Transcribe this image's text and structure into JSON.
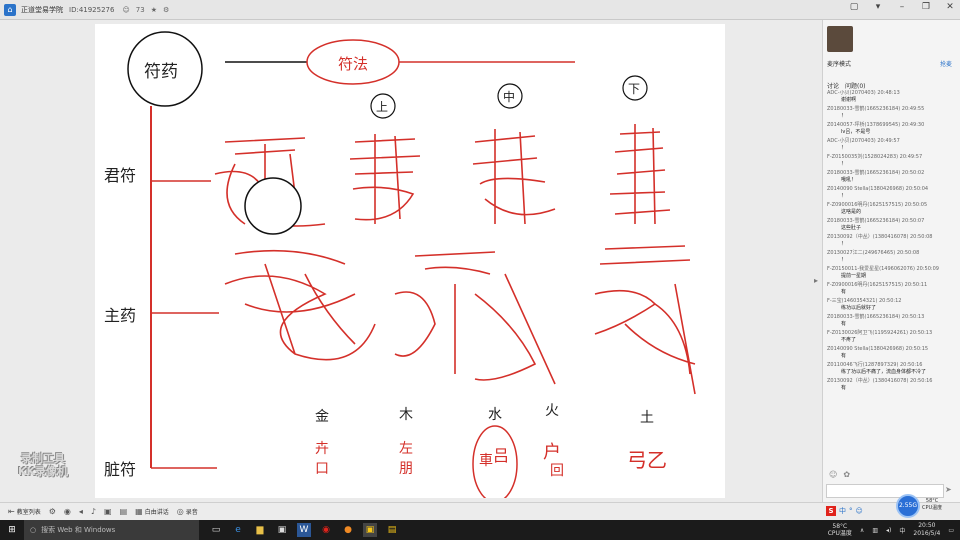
{
  "titlebar": {
    "title": "正道堂易学院",
    "id": "ID:41925276",
    "listeners": "73",
    "icons": [
      "app-icon",
      "people-icon",
      "star-icon",
      "settings-icon"
    ],
    "window_buttons": [
      "minimize",
      "restore",
      "close"
    ]
  },
  "slide": {
    "top_left": "符药",
    "top_center": "符法",
    "rows": [
      "君符",
      "主药",
      "脏符"
    ],
    "elements": [
      "金",
      "木",
      "水",
      "火",
      "土"
    ],
    "organs": [
      {
        "a": "卉",
        "b": "口"
      },
      {
        "a": "左",
        "b": "朋"
      },
      {
        "a": "車",
        "b": "吕"
      },
      {
        "a": "户",
        "b": "回"
      },
      {
        "a": "弓",
        "b": "乙"
      }
    ],
    "markers": [
      "上",
      "中",
      "下"
    ]
  },
  "watermark": {
    "line1": "录制工具",
    "line2": "KK录像机"
  },
  "panel": {
    "mode": "麦序模式",
    "signout": "抢麦",
    "tabs": [
      "讨论",
      "问题(0)"
    ],
    "messages": [
      {
        "head": "ADC-小贝(2070403) 20:48:13",
        "body": ""
      },
      {
        "head": "",
        "body": "谢谢啊"
      },
      {
        "head": "Z0180033-雪鹤(1665236184) 20:49:55",
        "body": "！"
      },
      {
        "head": "Z0140057-坪桥(1378699545) 20:49:30",
        "body": "lv吕，不是号"
      },
      {
        "head": "ADC-小贝(2070403) 20:49:57",
        "body": "！"
      },
      {
        "head": "F-Z0150035刘(1528024283) 20:49:57",
        "body": "！"
      },
      {
        "head": "Z0180033-雪鹤(1665236184) 20:50:02",
        "body": "哦吼！"
      },
      {
        "head": "Z0140090 Stella(1380426968) 20:50:04",
        "body": "！"
      },
      {
        "head": "F-Z0900016明丹(1625157515) 20:50:05",
        "body": "这啥是的"
      },
      {
        "head": "Z0180033-雪鹤(1665236184) 20:50:07",
        "body": "这些肚子"
      },
      {
        "head": "Z0130092（中丛）(1380416078) 20:50:08",
        "body": "！"
      },
      {
        "head": "Z0130027江二(249676465) 20:50:08",
        "body": "！"
      },
      {
        "head": "F-Z0150011-我爱星星(1496062076) 20:50:09",
        "body": "提前一星期"
      },
      {
        "head": "F-Z0900016明丹(1625157515) 20:50:11",
        "body": "有"
      },
      {
        "head": "F-三宝(1460354321) 20:50:12",
        "body": "练功以后就好了"
      },
      {
        "head": "Z0180033-雪鹤(1665236184) 20:50:13",
        "body": "有"
      },
      {
        "head": "F-Z0130026阿卫飞(1195924261) 20:50:13",
        "body": "不疼了"
      },
      {
        "head": "Z0140090 Stella(1380426968) 20:50:15",
        "body": "有"
      },
      {
        "head": "Z0110046飞行(1287897329) 20:50:16",
        "body": "练了功以后不痛了，流血身体都不冷了"
      },
      {
        "head": "Z0130092（中丛）(1380416078) 20:50:16",
        "body": "有"
      }
    ]
  },
  "toolbar": {
    "items": [
      "教室列表",
      "",
      "",
      "",
      "",
      "",
      "白由讲话",
      "录音"
    ],
    "ime": [
      "S",
      "中",
      "°",
      "☺"
    ],
    "gauge": "2.55G",
    "temp": "58°C",
    "cpu_label": "CPU温度"
  },
  "taskbar": {
    "search_placeholder": "搜索 Web 和 Windows",
    "tray_temp": "58°C",
    "tray_cpu": "CPU温度",
    "time": "20:50",
    "date": "2016/5/4"
  }
}
